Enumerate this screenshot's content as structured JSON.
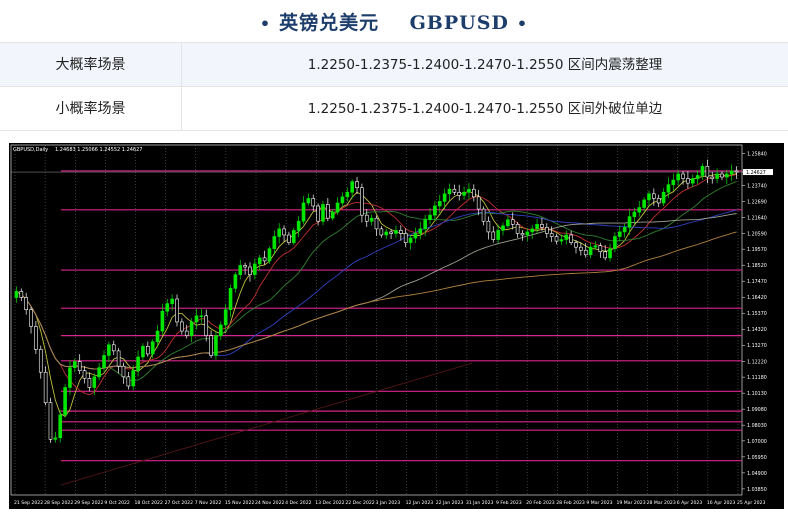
{
  "header": {
    "title": "英镑兑美元",
    "symbol": "GBPUSD",
    "bullet": "•"
  },
  "scenarios": [
    {
      "label": "大概率场景",
      "value": "1.2250-1.2375-1.2400-1.2470-1.2550 区间内震荡整理"
    },
    {
      "label": "小概率场景",
      "value": "1.2250-1.2375-1.2400-1.2470-1.2550 区间外破位单边"
    }
  ],
  "chart_data": {
    "type": "candlestick",
    "symbol_label": "GBPUSD,Daily",
    "ohlc_readout": "1.24683 1.25066 1.24552 1.24627",
    "price_axis_labels": [
      "1.25840",
      "1.24627",
      "1.23740",
      "1.22690",
      "1.21640",
      "1.20590",
      "1.19570",
      "1.18520",
      "1.17470",
      "1.16420",
      "1.15370",
      "1.14320",
      "1.13270",
      "1.12220",
      "1.11180",
      "1.10130",
      "1.09080",
      "1.08030",
      "1.07000",
      "1.05950",
      "1.04900",
      "1.03850"
    ],
    "date_axis_labels": [
      "21 Sep 2022",
      "28 Sep 2022",
      "29 Sep 2022",
      "9 Oct 2022",
      "18 Oct 2022",
      "27 Oct 2022",
      "7 Nov 2022",
      "15 Nov 2022",
      "24 Nov 2022",
      "4 Dec 2022",
      "13 Dec 2022",
      "22 Dec 2022",
      "3 Jan 2023",
      "12 Jan 2023",
      "22 Jan 2023",
      "31 Jan 2023",
      "9 Feb 2023",
      "20 Feb 2023",
      "28 Feb 2023",
      "9 Mar 2023",
      "19 Mar 2023",
      "28 Mar 2023",
      "6 Apr 2023",
      "16 Apr 2023",
      "25 Apr 2023"
    ],
    "price_range": [
      1.0345,
      1.264
    ],
    "current_price": 1.24627,
    "horizontal_levels": [
      1.247,
      1.2215,
      1.182,
      1.157,
      1.139,
      1.1225,
      1.1025,
      1.0895,
      1.0825,
      1.077,
      1.057
    ],
    "close_series": [
      1.168,
      1.164,
      1.156,
      1.145,
      1.13,
      1.115,
      1.095,
      1.071,
      1.072,
      1.087,
      1.105,
      1.118,
      1.122,
      1.116,
      1.111,
      1.105,
      1.112,
      1.118,
      1.126,
      1.133,
      1.129,
      1.119,
      1.112,
      1.106,
      1.116,
      1.125,
      1.132,
      1.127,
      1.135,
      1.142,
      1.155,
      1.16,
      1.163,
      1.148,
      1.142,
      1.139,
      1.148,
      1.152,
      1.152,
      1.139,
      1.126,
      1.139,
      1.146,
      1.156,
      1.17,
      1.179,
      1.185,
      1.184,
      1.179,
      1.186,
      1.19,
      1.188,
      1.196,
      1.204,
      1.209,
      1.205,
      1.2,
      1.208,
      1.214,
      1.226,
      1.229,
      1.224,
      1.214,
      1.225,
      1.216,
      1.22,
      1.226,
      1.23,
      1.233,
      1.24,
      1.236,
      1.218,
      1.214,
      1.216,
      1.209,
      1.205,
      1.207,
      1.206,
      1.208,
      1.206,
      1.2,
      1.203,
      1.206,
      1.209,
      1.215,
      1.218,
      1.224,
      1.227,
      1.232,
      1.235,
      1.233,
      1.231,
      1.233,
      1.235,
      1.23,
      1.222,
      1.214,
      1.207,
      1.202,
      1.208,
      1.211,
      1.215,
      1.212,
      1.206,
      1.205,
      1.207,
      1.209,
      1.212,
      1.21,
      1.206,
      1.204,
      1.201,
      1.202,
      1.205,
      1.2,
      1.197,
      1.195,
      1.192,
      1.197,
      1.198,
      1.194,
      1.19,
      1.196,
      1.204,
      1.207,
      1.21,
      1.217,
      1.22,
      1.223,
      1.228,
      1.232,
      1.229,
      1.226,
      1.233,
      1.238,
      1.241,
      1.245,
      1.242,
      1.239,
      1.242,
      1.244,
      1.25,
      1.243,
      1.242,
      1.245,
      1.243,
      1.245,
      1.247,
      1.2463
    ],
    "moving_average_colors": [
      "#c0c040",
      "#c03030",
      "#308030",
      "#3040c0",
      "#a0a090",
      "#b08040"
    ]
  }
}
